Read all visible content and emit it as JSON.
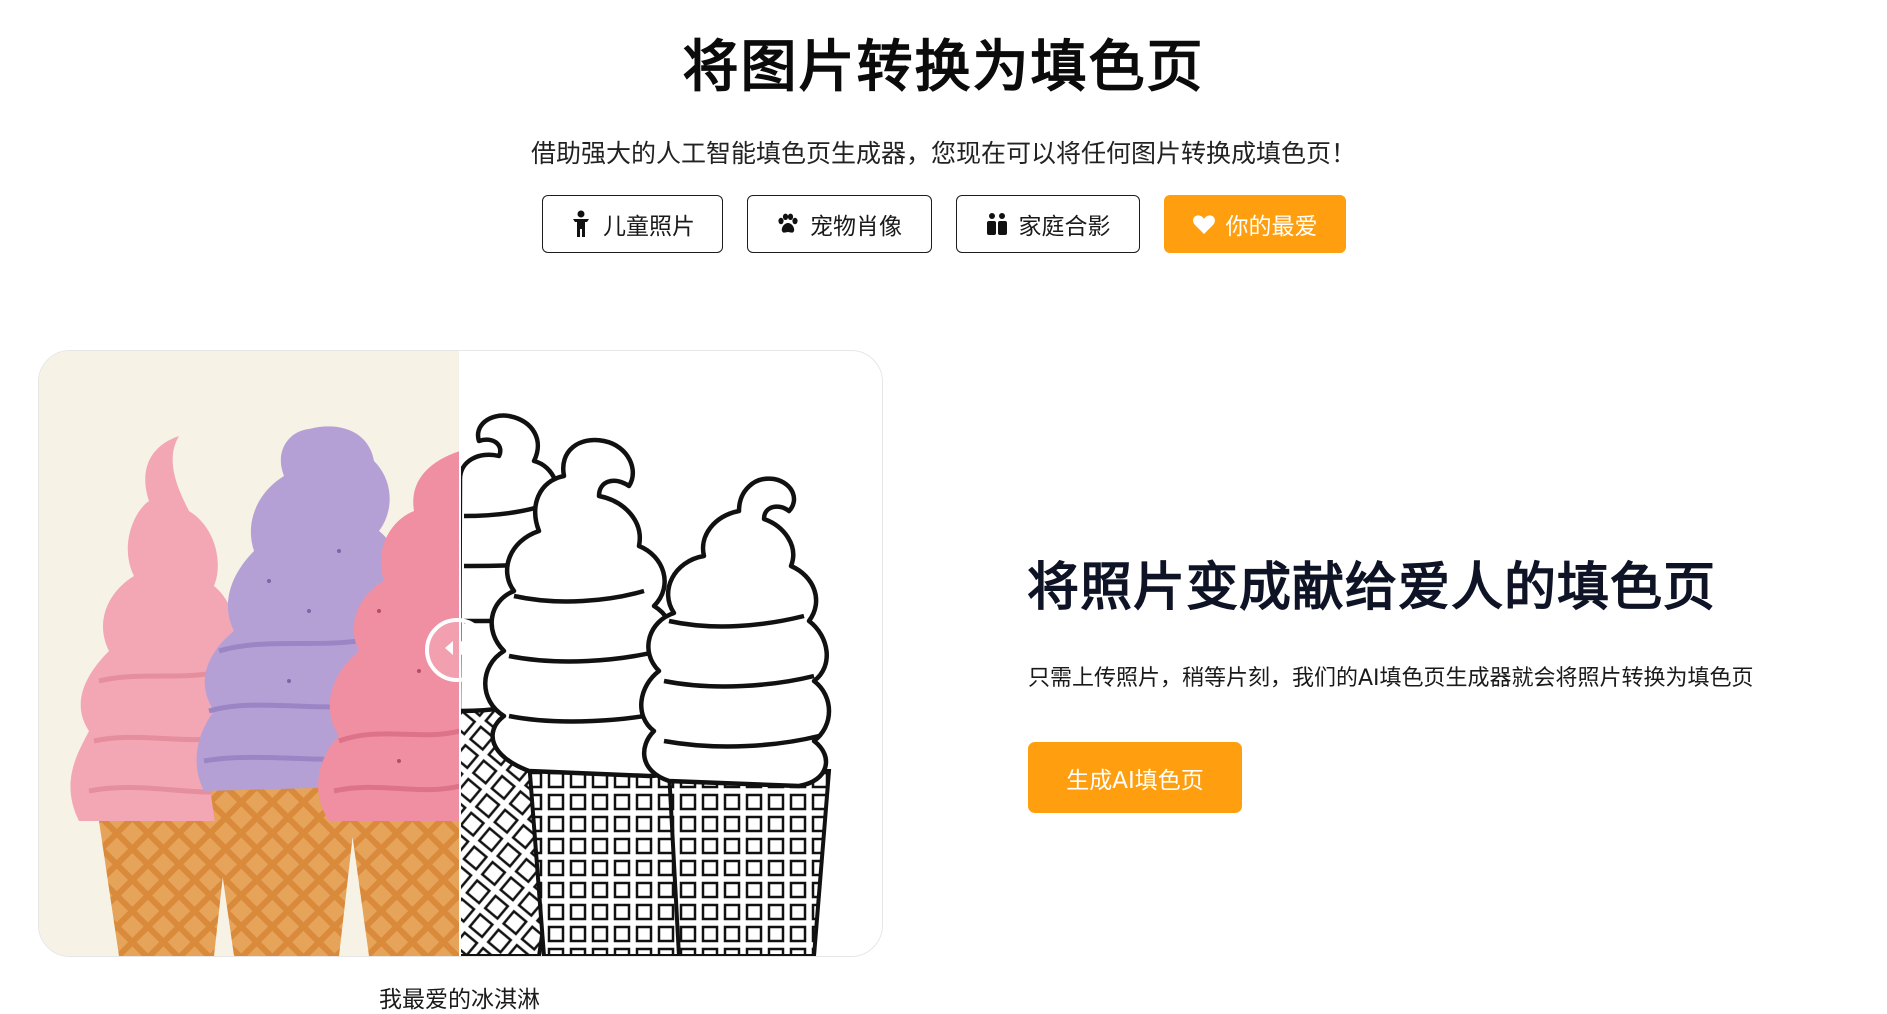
{
  "header": {
    "title": "将图片转换为填色页",
    "subtitle": "借助强大的人工智能填色页生成器，您现在可以将任何图片转换成填色页！"
  },
  "category_tabs": [
    {
      "label": "儿童照片",
      "icon": "child-icon",
      "active": false
    },
    {
      "label": "宠物肖像",
      "icon": "paw-icon",
      "active": false
    },
    {
      "label": "家庭合影",
      "icon": "family-icon",
      "active": false
    },
    {
      "label": "你的最爱",
      "icon": "heart-icon",
      "active": true
    }
  ],
  "compare": {
    "caption": "我最爱的冰淇淋",
    "slider_position": 0.5,
    "left_image": "ice-cream-photo",
    "right_image": "ice-cream-coloring-page"
  },
  "feature": {
    "heading": "将照片变成献给爱人的填色页",
    "description": "只需上传照片，稍等片刻，我们的AI填色页生成器就会将照片转换为填色页",
    "cta_label": "生成AI填色页"
  },
  "colors": {
    "accent": "#ff9f0f",
    "heading": "#0f1326",
    "photo_bg": "#f7f2e6",
    "pink_cream": "#f3a7b4",
    "purple_cream": "#b5a0d6",
    "cone": "#d98a3a"
  }
}
